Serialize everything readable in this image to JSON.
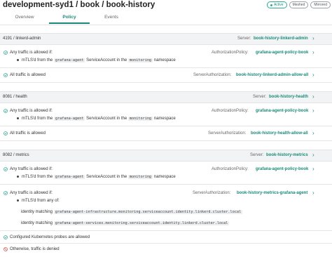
{
  "header": {
    "title": "development-syd1 / book / book-history",
    "badges": [
      "Active",
      "Meshed",
      "Mirrored"
    ]
  },
  "tabs": [
    "Overview",
    "Policy",
    "Events"
  ],
  "sections": [
    {
      "name": "4191 / linkerd-admin",
      "server_label": "Server:",
      "server_value": "book-history-linkerd-admin",
      "rules": [
        {
          "title": "Any traffic is allowed if:",
          "policy_label": "AuthorizationPolicy:",
          "policy_value": "grafana-agent-policy-book",
          "detail": {
            "prefix": "mTLS'd from the",
            "code": "grafana-agent",
            "middle": "ServiceAccount in the",
            "ns": "monitoring",
            "suffix": "namespace"
          }
        },
        {
          "title": "All traffic is allowed",
          "policy_label": "ServerAuthorization:",
          "policy_value": "book-history-linkerd-admin-allow-all"
        }
      ]
    },
    {
      "name": "8081 / health",
      "server_label": "Server:",
      "server_value": "book-history-health",
      "rules": [
        {
          "title": "Any traffic is allowed if:",
          "policy_label": "AuthorizationPolicy:",
          "policy_value": "grafana-agent-policy-book",
          "detail": {
            "prefix": "mTLS'd from the",
            "code": "grafana-agent",
            "middle": "ServiceAccount in the",
            "ns": "monitoring",
            "suffix": "namespace"
          }
        },
        {
          "title": "All traffic is allowed",
          "policy_label": "ServerAuthorization:",
          "policy_value": "book-history-health-allow-all"
        }
      ]
    },
    {
      "name": "8082 / metrics",
      "server_label": "Server:",
      "server_value": "book-history-metrics",
      "rules": [
        {
          "title": "Any traffic is allowed if:",
          "policy_label": "AuthorizationPolicy:",
          "policy_value": "grafana-agent-policy-book",
          "detail": {
            "prefix": "mTLS'd from the",
            "code": "grafana-agent",
            "middle": "ServiceAccount in the",
            "ns": "monitoring",
            "suffix": "namespace"
          }
        },
        {
          "title": "Any traffic is allowed if:",
          "policy_label": "ServerAuthorization:",
          "policy_value": "book-history-metrics-grafana-agent",
          "any_of": "mTLS'd from any of:",
          "identity_label": "identity matching",
          "identities": [
            "grafana-agent-infrastructure.monitoring.serviceaccount.identity.linkerd.cluster.local",
            "grafana-agent-services.monitoring.serviceaccount.identity.linkerd.cluster.local"
          ]
        }
      ]
    }
  ],
  "footer": {
    "probes": "Configured Kubernetes probes are allowed",
    "denied": "Otherwise, traffic is denied"
  },
  "colors": {
    "accent": "#1a8a78",
    "ok": "#2eaa94",
    "deny": "#d9534f"
  }
}
